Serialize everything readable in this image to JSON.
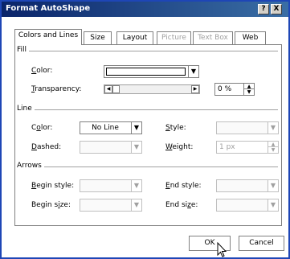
{
  "window": {
    "title": "Format AutoShape",
    "help_label": "?",
    "close_label": "X"
  },
  "tabs": [
    {
      "label": "Colors and Lines",
      "active": true
    },
    {
      "label": "Size"
    },
    {
      "label": "Layout"
    },
    {
      "label": "Picture",
      "disabled": true
    },
    {
      "label": "Text Box",
      "disabled": true
    },
    {
      "label": "Web"
    }
  ],
  "fill": {
    "heading": "Fill",
    "color_label_prefix": "C",
    "color_label_rest": "olor:",
    "color_swatch": "#ffffff",
    "transparency_label_prefix": "T",
    "transparency_label_rest": "ransparency:",
    "transparency_value": "0 %",
    "transparency_level": 0
  },
  "line": {
    "heading": "Line",
    "color_label_a": "C",
    "color_label_b": "o",
    "color_label_c": "lor:",
    "color_value": "No Line",
    "style_label_prefix": "S",
    "style_label_rest": "tyle:",
    "dashed_label_prefix": "D",
    "dashed_label_rest": "ashed:",
    "weight_label_prefix": "W",
    "weight_label_rest": "eight:",
    "weight_value": "1 px"
  },
  "arrows": {
    "heading": "Arrows",
    "begin_style_label_prefix": "B",
    "begin_style_label_rest": "egin style:",
    "end_style_label_prefix": "E",
    "end_style_label_rest": "nd style:",
    "begin_size_label_a": "Begin s",
    "begin_size_label_b": "i",
    "begin_size_label_c": "ze:",
    "end_size_label_a": "End si",
    "end_size_label_b": "z",
    "end_size_label_c": "e:"
  },
  "buttons": {
    "ok": "OK",
    "cancel": "Cancel"
  },
  "colors": {
    "title_bar": "#0a246a",
    "border": "#1e46b6"
  }
}
